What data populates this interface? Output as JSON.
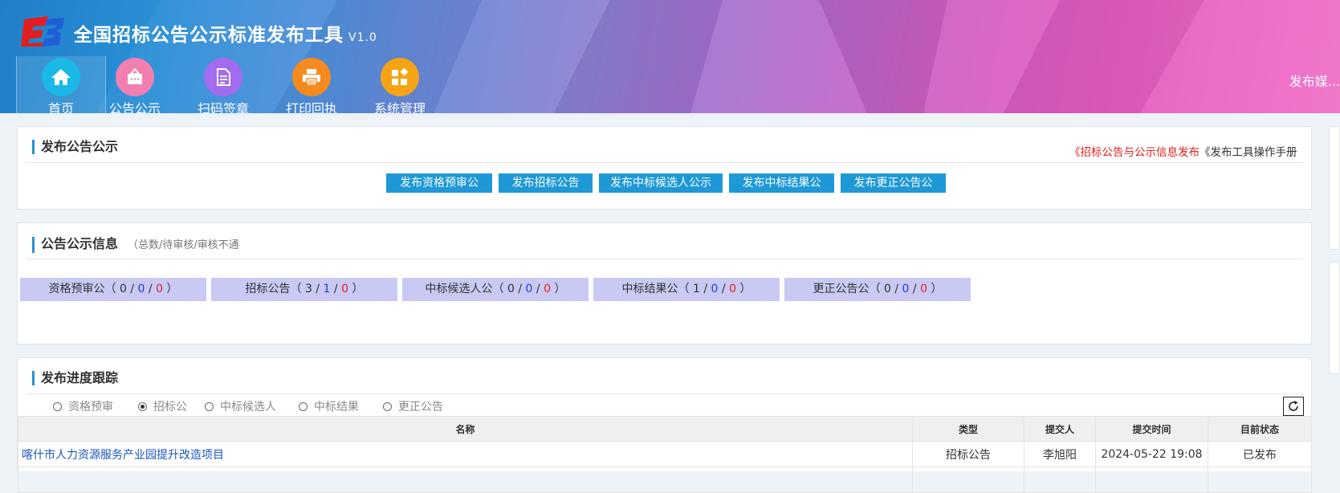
{
  "header": {
    "title": "全国招标公告公示标准发布工具",
    "version": "V1.0",
    "publish_media": "发布媒..."
  },
  "nav": [
    {
      "label": "首页",
      "icon": "home-icon",
      "color": "#19b8e6",
      "active": true
    },
    {
      "label": "公告公示",
      "icon": "notice-board-icon",
      "color": "#f17fb0",
      "active": false
    },
    {
      "label": "扫码签章",
      "icon": "document-icon",
      "color": "#a36cf0",
      "active": false
    },
    {
      "label": "打印回执",
      "icon": "printer-icon",
      "color": "#f58a1f",
      "active": false
    },
    {
      "label": "系统管理",
      "icon": "grid-settings-icon",
      "color": "#f5a416",
      "active": false
    }
  ],
  "publish_panel": {
    "title": "发布公告公示",
    "link1": "《招标公告与公示信息发布",
    "link2": "《发布工具操作手册",
    "buttons": [
      "发布资格预审公",
      "发布招标公告",
      "发布中标候选人公示",
      "发布中标结果公",
      "发布更正公告公"
    ]
  },
  "info_panel": {
    "title": "公告公示信息",
    "note": "（总数/待审核/审核不通",
    "stats": [
      {
        "label": "资格预审公",
        "total": "0",
        "pending": "0",
        "rejected": "0"
      },
      {
        "label": "招标公告",
        "total": "3",
        "pending": "1",
        "rejected": "0"
      },
      {
        "label": "中标候选人公",
        "total": "0",
        "pending": "0",
        "rejected": "0"
      },
      {
        "label": "中标结果公",
        "total": "1",
        "pending": "0",
        "rejected": "0"
      },
      {
        "label": "更正公告公",
        "total": "0",
        "pending": "0",
        "rejected": "0"
      }
    ]
  },
  "progress_panel": {
    "title": "发布进度跟踪",
    "filters": [
      {
        "label": "资格预审",
        "checked": false
      },
      {
        "label": "招标公",
        "checked": true
      },
      {
        "label": "中标候选人",
        "checked": false
      },
      {
        "label": "中标结果",
        "checked": false
      },
      {
        "label": "更正公告",
        "checked": false
      }
    ],
    "columns": {
      "name": "名称",
      "type": "类型",
      "submitter": "提交人",
      "time": "提交时间",
      "status": "目前状态"
    },
    "rows": [
      {
        "name": "喀什市人力资源服务产业园提升改造项目",
        "type": "招标公告",
        "submitter": "李旭阳",
        "time": "2024-05-22 19:08",
        "status": "已发布"
      }
    ]
  }
}
